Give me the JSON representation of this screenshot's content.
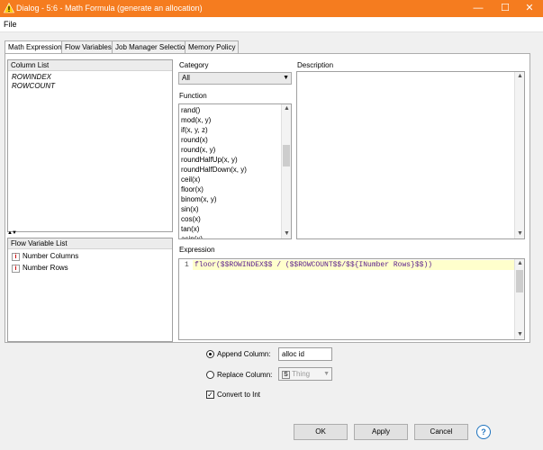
{
  "window": {
    "title": "Dialog - 5:6 - Math Formula (generate an allocation)",
    "controls": [
      "—",
      "☐",
      "✕"
    ]
  },
  "menu": {
    "file": "File"
  },
  "tabs": [
    {
      "label": "Math Expression",
      "active": true
    },
    {
      "label": "Flow Variables",
      "active": false
    },
    {
      "label": "Job Manager Selection",
      "active": false
    },
    {
      "label": "Memory Policy",
      "active": false
    }
  ],
  "column_list": {
    "header": "Column List",
    "items": [
      "ROWINDEX",
      "ROWCOUNT"
    ]
  },
  "flow_variable_list": {
    "header": "Flow Variable List",
    "items": [
      "Number Columns",
      "Number Rows"
    ],
    "icon_glyph": "i"
  },
  "category": {
    "label": "Category",
    "value": "All"
  },
  "function": {
    "label": "Function",
    "items": [
      "rand()",
      "mod(x, y)",
      "if(x, y, z)",
      "round(x)",
      "round(x, y)",
      "roundHalfUp(x, y)",
      "roundHalfDown(x, y)",
      "ceil(x)",
      "floor(x)",
      "binom(x, y)",
      "sin(x)",
      "cos(x)",
      "tan(x)",
      "asin(x)"
    ]
  },
  "description": {
    "label": "Description"
  },
  "expression": {
    "label": "Expression",
    "line_number": "1",
    "code": "floor($$ROWINDEX$$ / ($$ROWCOUNT$$/$${INumber Rows}$$))"
  },
  "options": {
    "append": {
      "label": "Append Column:",
      "value": "alloc id",
      "selected": true
    },
    "replace": {
      "label": "Replace Column:",
      "type_badge": "S",
      "value": "Thing",
      "selected": false
    },
    "convert": {
      "label": "Convert to Int",
      "checked": true
    }
  },
  "buttons": {
    "ok": "OK",
    "apply": "Apply",
    "cancel": "Cancel",
    "help": "?"
  },
  "colors": {
    "titlebar": "#f57c1f",
    "highlight_line": "#ffffcc",
    "help_icon": "#1e73be",
    "flow_icon": "#cc0000"
  }
}
